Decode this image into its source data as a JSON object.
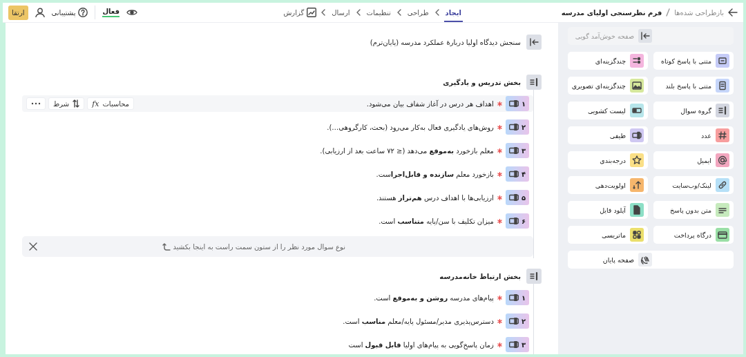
{
  "header": {
    "breadcrumb_parent": "بازطراحی شده‌ها",
    "breadcrumb_current": "فرم نظرسنجی اولیای مدرسه",
    "steps": [
      {
        "label": "ایجاد",
        "selected": true
      },
      {
        "label": "طراحی",
        "selected": false
      },
      {
        "label": "تنظیمات",
        "selected": false
      },
      {
        "label": "ارسال",
        "selected": false
      }
    ],
    "report": "گزارش",
    "status": {
      "label": "فعال",
      "active": true
    },
    "support": "پشتیبانی",
    "upgrade": "ارتقا"
  },
  "form_title": "سنجش دیدگاه اولیا دربارهٔ عملکرد مدرسه (پایان‌ترم)",
  "sections": [
    {
      "title": "بخش تدریس و یادگیری",
      "questions": [
        {
          "number": "۱",
          "text": "اهداف هر درس در آغاز شفاف بیان می‌شود.",
          "required": true,
          "selected": true
        },
        {
          "number": "۲",
          "text": "روش‌های یادگیری فعال به‌کار می‌رود (بحث، کارگروهی…).",
          "required": true,
          "selected": false
        },
        {
          "number": "۳",
          "text": "معلم بازخورد **به‌موقع** می‌دهد (≤ ۷۲ ساعت بعد از ارزیابی).",
          "required": true,
          "selected": false
        },
        {
          "number": "۴",
          "text": "بازخورد معلم **سازنده و قابل‌اجرا**ست.",
          "required": true,
          "selected": false
        },
        {
          "number": "۵",
          "text": "ارزیابی‌ها با اهداف درس **هم‌تراز** هستند.",
          "required": true,
          "selected": false
        },
        {
          "number": "۶",
          "text": "میزان تکلیف با سن/پایه **متناسب** است.",
          "required": true,
          "selected": false
        }
      ],
      "drop_hint": "نوع سوال مورد نظر را از ستون سمت راست به اینجا بکشید"
    },
    {
      "title": "بخش ارتباط خانه‌مدرسه",
      "questions": [
        {
          "number": "۱",
          "text": "پیام‌های مدرسه **روشن و به‌موقع** است.",
          "required": true,
          "selected": false
        },
        {
          "number": "۲",
          "text": "دسترس‌پذیری مدیر/مسئول پایه/معلم **مناسب** است.",
          "required": true,
          "selected": false
        },
        {
          "number": "۳",
          "text": "زمان پاسخ‌گویی به پیام‌های اولیا **قابل قبول** است",
          "required": true,
          "selected": false
        }
      ]
    }
  ],
  "question_toolbar": {
    "actions": [
      {
        "label": "محاسبات",
        "symbol": "fx",
        "kind": "calc"
      },
      {
        "label": "شرط",
        "kind": "condition"
      }
    ]
  },
  "palette": [
    {
      "label": "صفحه خوش‌آمد گویی",
      "kind": "welcome",
      "disabled": true,
      "color": "#dfe2e8"
    },
    {
      "label": "متنی با پاسخ کوتاه",
      "kind": "short",
      "disabled": false,
      "color": "#c5cbf7"
    },
    {
      "label": "چندگزینه‌ای",
      "kind": "choice",
      "disabled": false,
      "color": "#f4b5de"
    },
    {
      "label": "متنی با پاسخ بلند",
      "kind": "long",
      "disabled": false,
      "color": "#c6d6fa"
    },
    {
      "label": "چندگزینه‌ای تصویری",
      "kind": "image",
      "disabled": false,
      "color": "#d6e89c"
    },
    {
      "label": "گروه سوال",
      "kind": "group",
      "disabled": false,
      "color": "#d3d6e0"
    },
    {
      "label": "لیست کشویی",
      "kind": "dropdown",
      "disabled": false,
      "color": "#b6e5ea"
    },
    {
      "label": "عدد",
      "kind": "number",
      "disabled": false,
      "color": "#f79e9e"
    },
    {
      "label": "طیفی",
      "kind": "scale",
      "disabled": false,
      "color": "#cfc8f2"
    },
    {
      "label": "ایمیل",
      "kind": "email",
      "disabled": false,
      "color": "#f2a6bf"
    },
    {
      "label": "درجه‌بندی",
      "kind": "rating",
      "disabled": false,
      "color": "#fadf86"
    },
    {
      "label": "لینک/وب‌سایت",
      "kind": "link",
      "disabled": false,
      "color": "#b6e0f7"
    },
    {
      "label": "اولویت‌دهی",
      "kind": "rank",
      "disabled": false,
      "color": "#f6b66c"
    },
    {
      "label": "متن بدون پاسخ",
      "kind": "statement",
      "disabled": false,
      "color": "#c6eabd"
    },
    {
      "label": "آپلود فایل",
      "kind": "file",
      "disabled": false,
      "color": "#8cdfc6"
    },
    {
      "label": "درگاه پرداخت",
      "kind": "payment",
      "disabled": false,
      "color": "#9adfa6"
    },
    {
      "label": "ماتریسی",
      "kind": "matrix",
      "disabled": false,
      "color": "#ebdf6c"
    },
    {
      "label": "صفحه پایان",
      "kind": "end",
      "disabled": false,
      "color": "#eceef2"
    }
  ]
}
